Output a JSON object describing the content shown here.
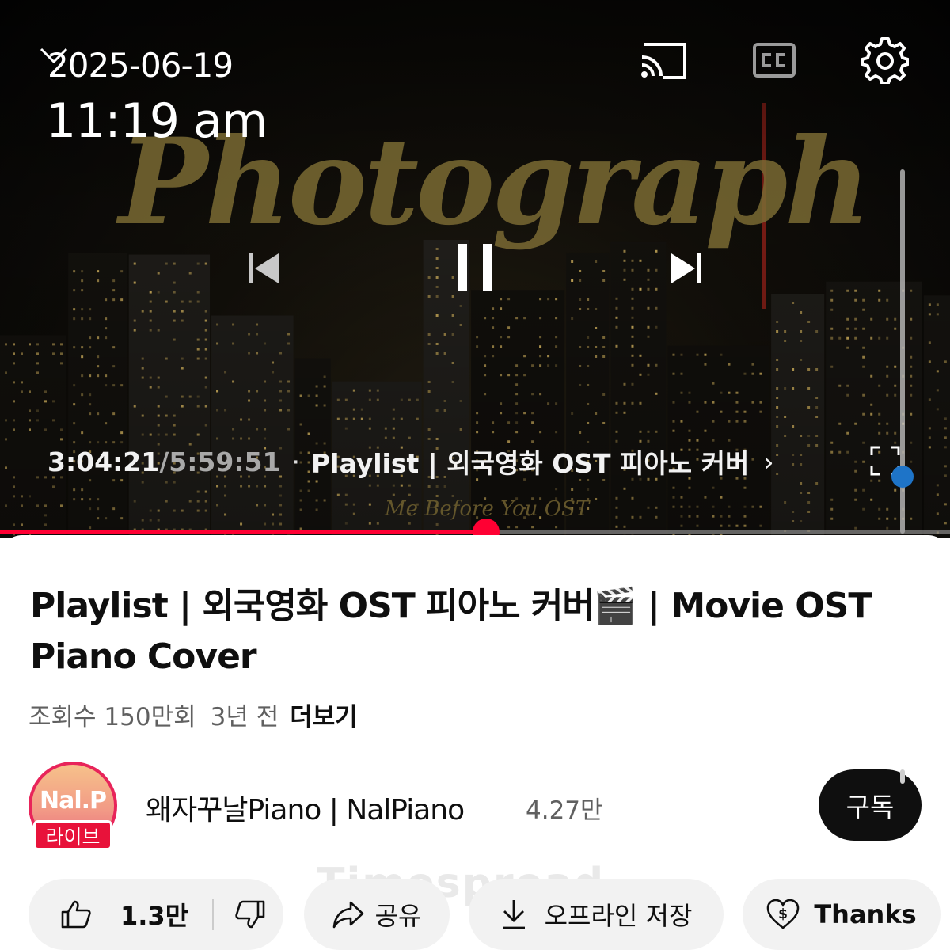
{
  "status": {
    "date": "2025-06-19",
    "time": "11:19 am"
  },
  "player": {
    "overlay_title": "Photograph",
    "overlay_subtitle": "Me Before You OST",
    "current_time": "3:04:21",
    "separator": " / ",
    "total_time": "5:59:51",
    "dot": "·",
    "chapter": "Playlist | 외국영화 OST 피아노 커버",
    "chapter_chevron": "›",
    "progress": 0.512,
    "accent_color": "#ff0033",
    "icons": [
      "collapse-chevron-icon",
      "cast-icon",
      "cc-icon",
      "settings-gear-icon",
      "previous-icon",
      "pause-icon",
      "next-icon",
      "fullscreen-icon"
    ]
  },
  "video": {
    "title": "Playlist | 외국영화 OST 피아노 커버🎬 | Movie OST Piano Cover",
    "views": "조회수 150만회",
    "ago": "3년 전",
    "more": "더보기"
  },
  "channel": {
    "avatar_text": "Nal.P",
    "live_badge": "라이브",
    "name": "왜자꾸날Piano | NalPiano",
    "subscribers": "4.27만",
    "subscribe_label": "구독"
  },
  "watermark": "Timespread",
  "actions": {
    "like_count": "1.3만",
    "share_label": "공유",
    "download_label": "오프라인 저장",
    "thanks_label": "Thanks"
  }
}
